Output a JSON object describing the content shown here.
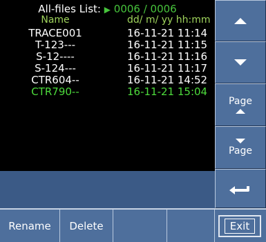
{
  "header": {
    "title": "All-files List:",
    "arrow_icon": "play-arrow-icon",
    "file_count": "0006 / 0006"
  },
  "columns": {
    "name": "Name",
    "date": "dd/ m/ yy  hh:mm"
  },
  "files": [
    {
      "name": "TRACE001",
      "date": "16-11-21 11:14",
      "selected": false
    },
    {
      "name": "T-123---",
      "date": "16-11-21 11:15",
      "selected": false
    },
    {
      "name": "S-12----",
      "date": "16-11-21 11:16",
      "selected": false
    },
    {
      "name": "S-124---",
      "date": "16-11-21 11:17",
      "selected": false
    },
    {
      "name": "CTR604--",
      "date": "16-11-21 14:52",
      "selected": false
    },
    {
      "name": "CTR790--",
      "date": "16-11-21 15:04",
      "selected": true
    }
  ],
  "side_buttons": {
    "up_icon": "arrow-up-icon",
    "down_icon": "arrow-down-icon",
    "page_up_label": "Page",
    "page_down_label": "Page",
    "back_icon": "return-arrow-icon"
  },
  "soft_keys": {
    "rename": "Rename",
    "delete": "Delete",
    "exit": "Exit"
  },
  "colors": {
    "list_background": "#000000",
    "selected_file": "#4ddb3c",
    "header_count": "#47c43c",
    "column_header": "#9fd45c",
    "button_face": "#4e6f9c"
  }
}
